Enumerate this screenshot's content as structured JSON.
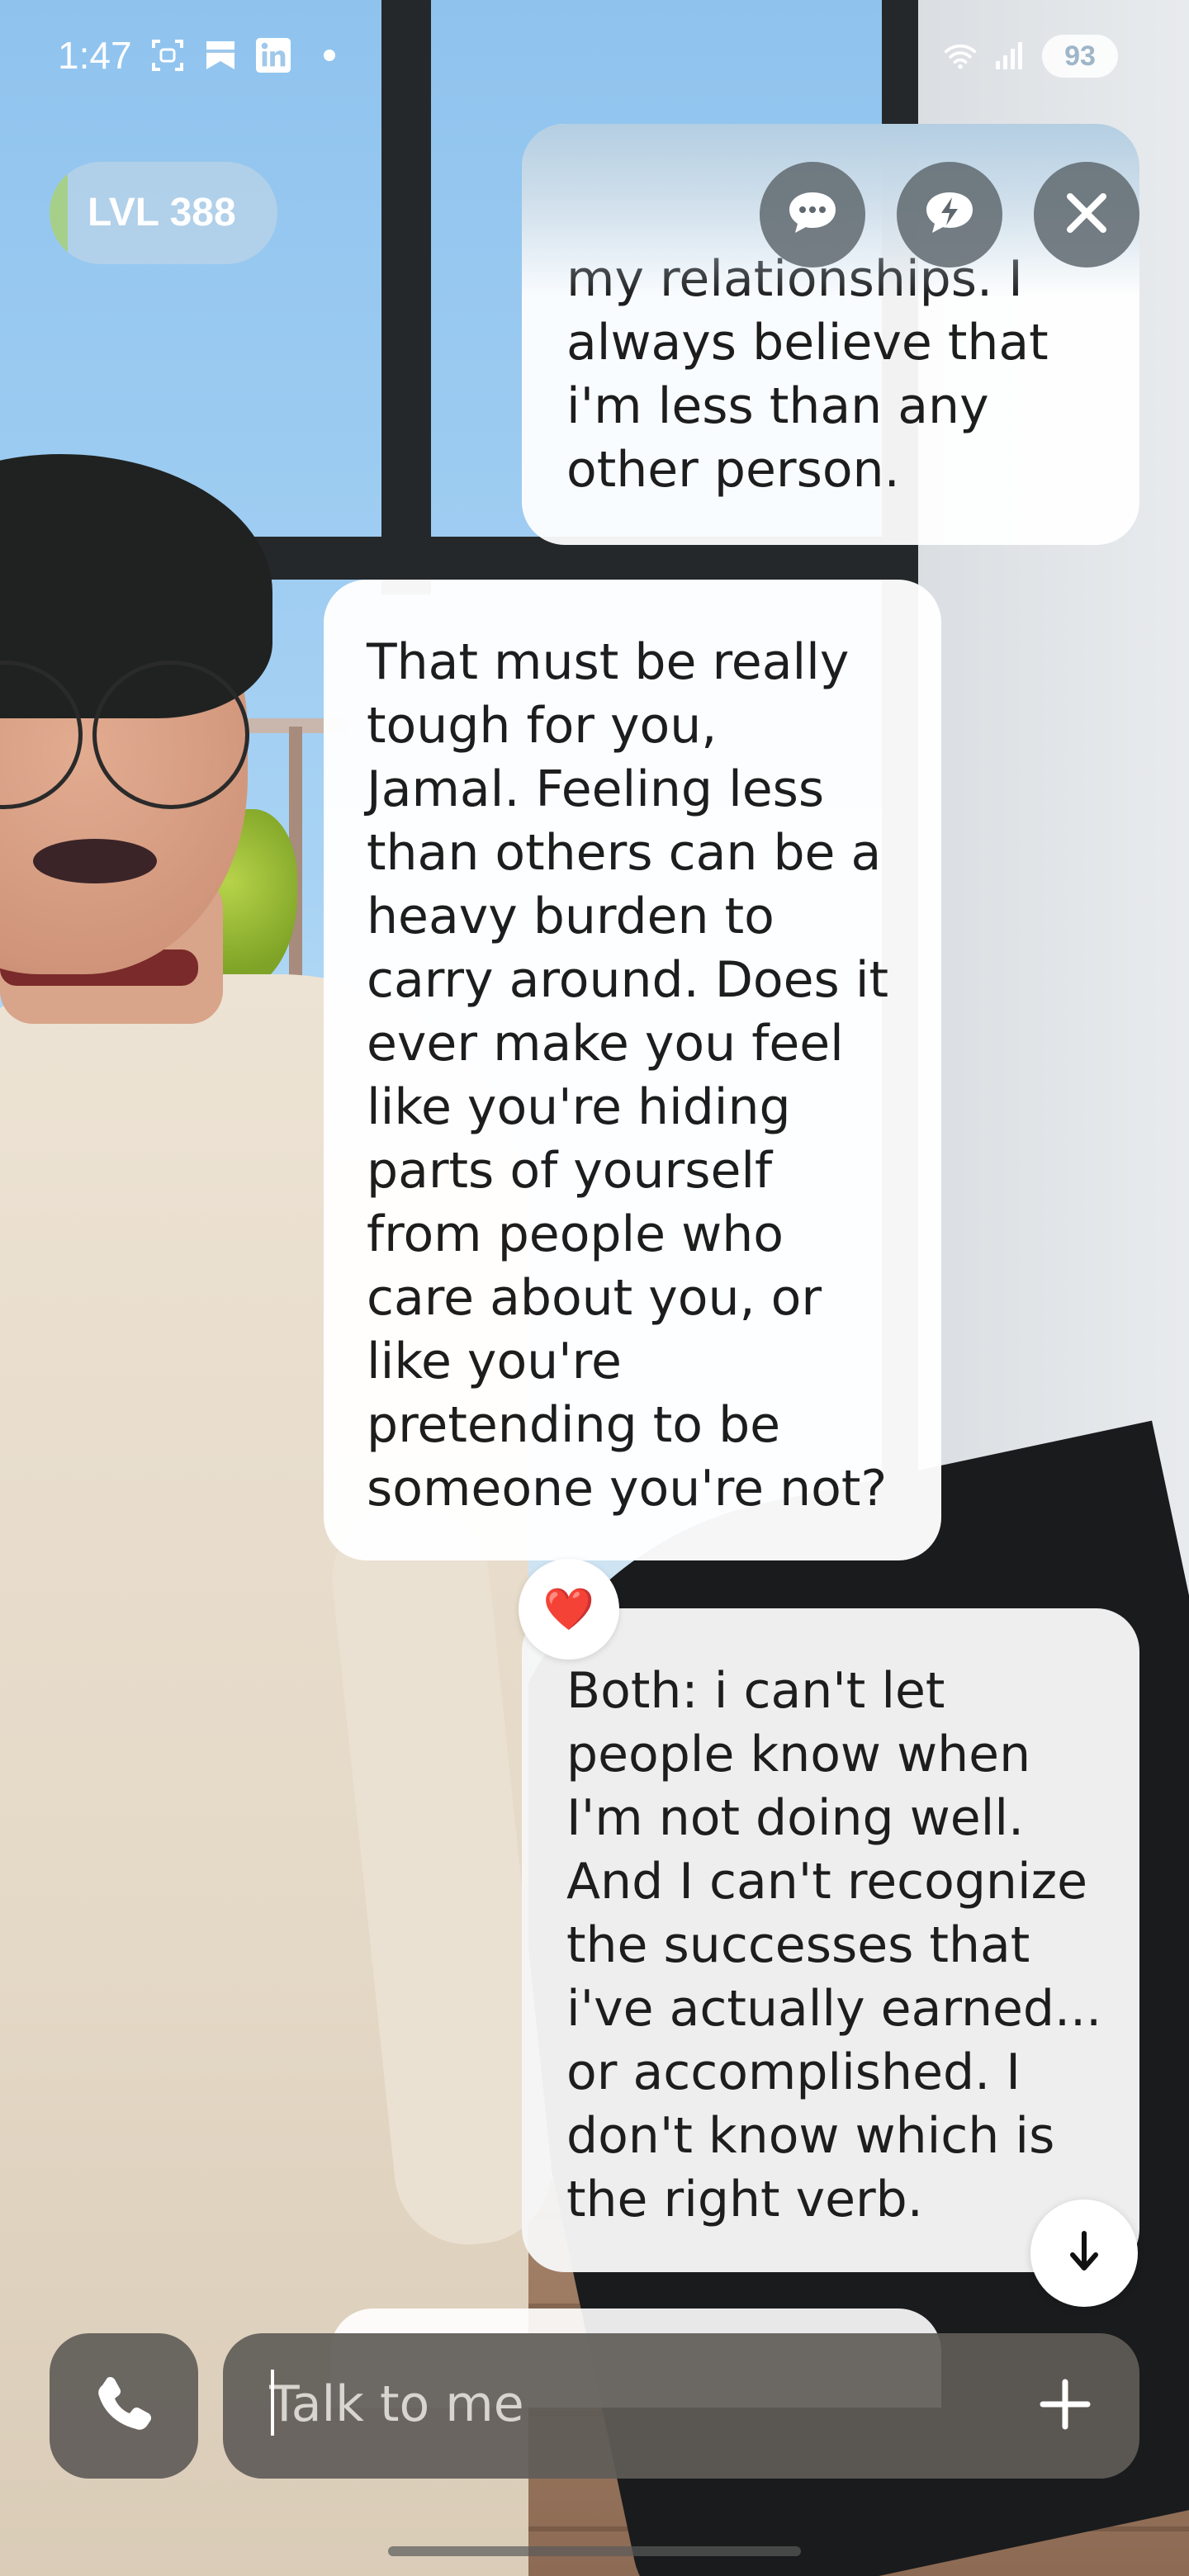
{
  "status_bar": {
    "time": "1:47",
    "battery": "93",
    "icons": [
      "screenshot-icon",
      "bookmark-icon",
      "linkedin-icon",
      "notification-dot",
      "wifi-icon",
      "signal-icon"
    ]
  },
  "header": {
    "level_label": "LVL 388",
    "buttons": [
      "chat-icon",
      "quick-reply-icon",
      "close-icon"
    ]
  },
  "chat": {
    "messages": [
      {
        "sender": "user",
        "text": "my relationships. I\nalways believe that\ni'm less than any\nother person."
      },
      {
        "sender": "ai",
        "text": "That must be really\ntough for you,\nJamal. Feeling less\nthan others can be a\nheavy burden to\ncarry around. Does it\never make you feel\nlike you're hiding\nparts of yourself\nfrom people who\ncare about you, or\nlike you're\npretending to be\nsomeone you're not?",
        "reaction": "❤️"
      },
      {
        "sender": "user",
        "text": "Both: i can't let\npeople know when\nI'm not doing well.\nAnd I can't recognize\nthe successes that\ni've actually earned...\nor accomplished. I\ndon't know which is\nthe right verb."
      }
    ]
  },
  "composer": {
    "placeholder": "Talk to me",
    "value": ""
  },
  "colors": {
    "bubble": "#ffffff",
    "control_bg": "#5f686e",
    "composer_bg": "#605c58",
    "level_accent": "#a6d08a"
  }
}
